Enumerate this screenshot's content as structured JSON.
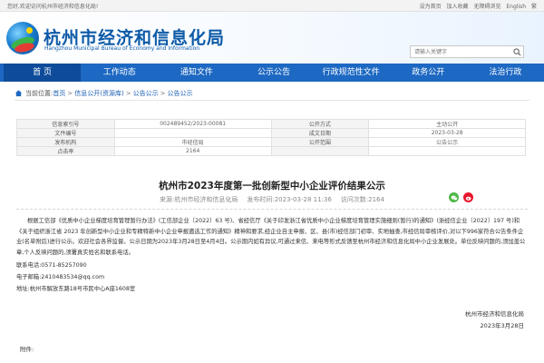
{
  "topbar": {
    "welcome": "您好,欢迎访问杭州市经济和信息化局!",
    "links": [
      "设为首页",
      "加入收藏",
      "无障碍浏览",
      "English",
      "繁"
    ]
  },
  "site": {
    "name": "杭州市经济和信息化局",
    "en": "Hangzhou Municipal Bureau of Economy and Information"
  },
  "search": {
    "placeholder": "请输入关键字"
  },
  "nav": [
    "首 页",
    "工作动态",
    "通知文件",
    "公示公告",
    "行政规范性文件",
    "政务公开",
    "法治行政"
  ],
  "breadcrumb": {
    "prefix": "当前位置:",
    "items": [
      "首页",
      "信息公开(资源库)",
      "公告公示",
      "公告公示"
    ]
  },
  "meta": {
    "rows": [
      [
        "信息索引号",
        "002489452/2023-00081",
        "公开方式",
        "主动公开"
      ],
      [
        "文件编号",
        "",
        "成文日期",
        "2023-03-28"
      ],
      [
        "发布机构",
        "市经信局",
        "公开范围",
        "公告公示"
      ],
      [
        "点击率",
        "2164",
        "",
        ""
      ]
    ]
  },
  "article": {
    "title": "杭州市2023年度第一批创新型中小企业评价结果公示",
    "source": "来源:杭州市经济和信息化局",
    "date": "发布时间:2023-03-28 11:36",
    "views": "访问次数:2164",
    "para1": "根据工信部《优质中小企业梯度培育管理暂行办法》(工信部企业〔2022〕63 号)、省经信厅《关于印发浙江省优质中小企业梯度培育管理实施细则(暂行)的通知》(浙经信企业〔2022〕197 号)和《关于组织浙江省 2023 年创新型中小企业和专精特新中小企业申报遴选工作的通知》精神和要求,经企业自主申报、区、县(市)经信部门初审、实地抽查,市经信局审核评价,对以下996家符合公告条件企业(名单附后)进行公示。欢迎社会各界监督。公示日期为2023年3月28日至4月4日。公示期内如有异议,可通过来信、来电等形式反馈至杭州市经济和信息化局中小企业发展处。单位反映问题的,须加盖公章,个人反映问题的,须署真实姓名和联系电话。",
    "phone": "联系电话:0571-85257090",
    "email": "电子邮箱:2410483534@qq.com",
    "address": "地址:杭州市解放东路18号市民中心A座1608室",
    "sign_org": "杭州市经济和信息化局",
    "sign_date": "2023年3月28日",
    "attach": "附件:"
  },
  "colors": {
    "nav": "#1d68c2",
    "nav_active": "#0e4c9a",
    "brand": "#0d5aa7",
    "wechat": "#4fb848",
    "weibo": "#e6162d"
  }
}
